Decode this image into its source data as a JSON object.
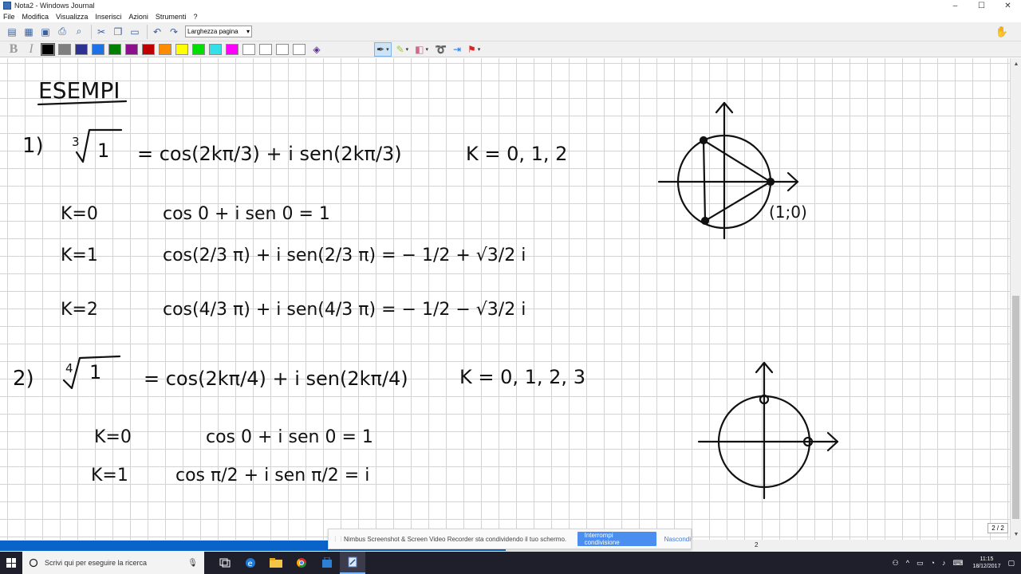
{
  "window": {
    "title": "Nota2 - Windows Journal",
    "controls": [
      "–",
      "☐",
      "✕"
    ]
  },
  "menu": [
    "File",
    "Modifica",
    "Visualizza",
    "Inserisci",
    "Azioni",
    "Strumenti",
    "?"
  ],
  "toolbar": {
    "zoom_value": "Larghezza pagina",
    "format_bold": "B",
    "format_italic": "I"
  },
  "palette": [
    "#000000",
    "#7f7f7f",
    "#2e3192",
    "#1e72e8",
    "#008000",
    "#8e0f8e",
    "#c00000",
    "#ff8c00",
    "#ffff00",
    "#00e000",
    "#33e0e8",
    "#ff00ff",
    "#ffffff",
    "#ffffff",
    "#ffffff",
    "#ffffff"
  ],
  "note": {
    "heading": "ESEMPI",
    "ex1": {
      "num": "1)",
      "root_index": "3",
      "root_arg": "1",
      "formula": "= cos(2kπ/3) + i sen(2kπ/3)",
      "k_values": "K = 0, 1, 2",
      "rows": [
        {
          "k": "K=0",
          "expr": "cos 0 + i sen 0 = 1"
        },
        {
          "k": "K=1",
          "expr": "cos(2/3 π) + i sen(2/3 π) = − 1/2 + √3/2 i"
        },
        {
          "k": "K=2",
          "expr": "cos(4/3 π) + i sen(4/3 π) = − 1/2 − √3/2 i"
        }
      ],
      "point_label": "(1;0)"
    },
    "ex2": {
      "num": "2)",
      "root_index": "4",
      "root_arg": "1",
      "formula": "= cos(2kπ/4) + i sen(2kπ/4)",
      "k_values": "K = 0, 1, 2, 3",
      "rows": [
        {
          "k": "K=0",
          "expr": "cos 0 + i sen 0 = 1"
        },
        {
          "k": "K=1",
          "expr": "cos π/2 + i sen π/2 = i"
        }
      ]
    }
  },
  "scroll": {
    "page_indicator": "2 / 2"
  },
  "status": {
    "page_number": "2"
  },
  "share_banner": {
    "message": "Nimbus Screenshot & Screen Video Recorder sta condividendo il tuo schermo.",
    "stop_label": "Interrompi condivisione",
    "hide_label": "Nascondi"
  },
  "taskbar": {
    "search_placeholder": "Scrivi qui per eseguire la ricerca",
    "time": "11:15",
    "date": "18/12/2017"
  }
}
